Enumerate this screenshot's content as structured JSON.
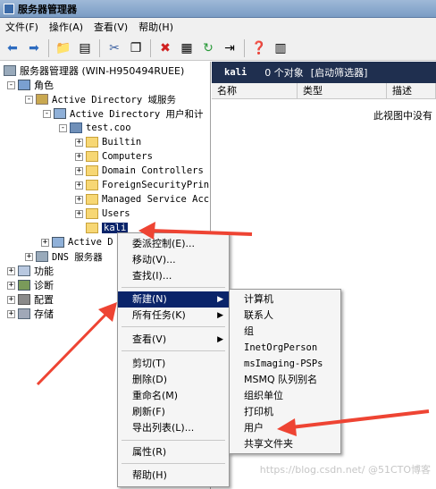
{
  "window": {
    "title": "服务器管理器"
  },
  "menubar": [
    "文件(F)",
    "操作(A)",
    "查看(V)",
    "帮助(H)"
  ],
  "tree": {
    "root": "服务器管理器 (WIN-H950494RUEE)",
    "roles": "角色",
    "ad": "Active Directory 域服务",
    "aduc": "Active Directory 用户和计",
    "domain": "test.coo",
    "children": [
      "Builtin",
      "Computers",
      "Domain Controllers",
      "ForeignSecurityPrin",
      "Managed Service Acc",
      "Users"
    ],
    "selected": "kali",
    "ad_partial": "Active D",
    "dns": "DNS 服务器",
    "others": [
      "功能",
      "诊断",
      "配置",
      "存储"
    ]
  },
  "rightpane": {
    "header_name": "kali",
    "header_count": "0 个对象",
    "header_filter": "[启动筛选器]",
    "columns": [
      "名称",
      "类型",
      "描述"
    ],
    "empty_text": "此视图中没有"
  },
  "context_menu": {
    "items": [
      "委派控制(E)...",
      "移动(V)...",
      "查找(I)...",
      "新建(N)",
      "所有任务(K)",
      "查看(V)",
      "剪切(T)",
      "删除(D)",
      "重命名(M)",
      "刷新(F)",
      "导出列表(L)...",
      "属性(R)",
      "帮助(H)"
    ]
  },
  "submenu": {
    "items": [
      "计算机",
      "联系人",
      "组",
      "InetOrgPerson",
      "msImaging-PSPs",
      "MSMQ 队列别名",
      "组织单位",
      "打印机",
      "用户",
      "共享文件夹"
    ]
  },
  "watermark": "https://blog.csdn.net/ @51CTO博客",
  "colors": {
    "selection": "#0a246a",
    "annotation_arrow": "#ee4433"
  }
}
